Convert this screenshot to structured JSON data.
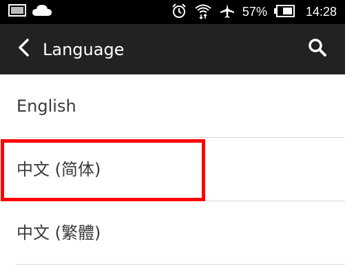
{
  "status_bar": {
    "battery_percent": "57%",
    "time": "14:28",
    "icons": [
      "image-icon",
      "cloud-icon",
      "alarm-icon",
      "wifi-icon",
      "airplane-icon",
      "battery-icon"
    ]
  },
  "app_bar": {
    "title": "Language",
    "back_icon": "back-icon",
    "search_icon": "search-icon"
  },
  "languages": [
    {
      "label": "English"
    },
    {
      "label": "中文 (简体)"
    },
    {
      "label": "中文 (繁體)"
    }
  ],
  "colors": {
    "status_bar_bg": "#000000",
    "app_bar_bg": "#222222",
    "highlight": "#ff0000",
    "divider": "#d8d8d8"
  }
}
